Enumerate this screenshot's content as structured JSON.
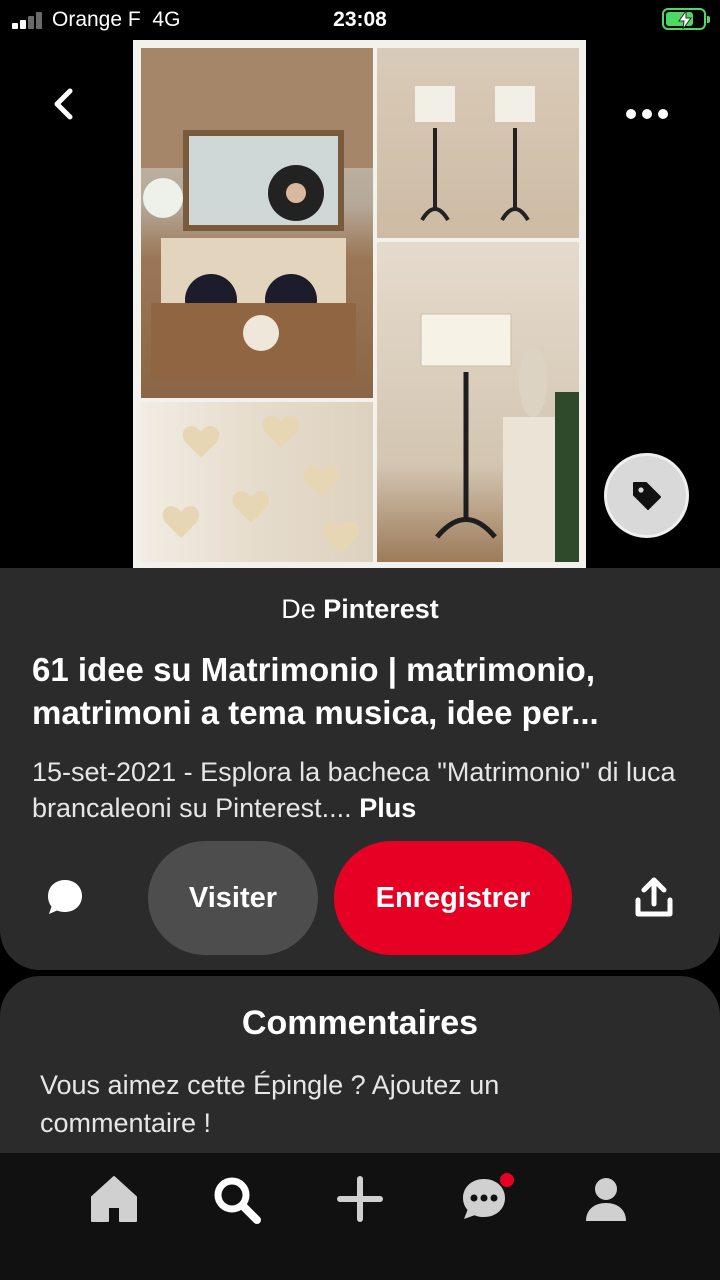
{
  "status_bar": {
    "carrier": "Orange F",
    "network": "4G",
    "time": "23:08",
    "battery_level": 0.75,
    "battery_charging": true,
    "signal_bars_active": 2,
    "signal_bars_total": 4
  },
  "header": {
    "back_icon": "chevron-left-icon",
    "more_icon": "more-horizontal-icon",
    "tag_icon": "tag-icon"
  },
  "pin": {
    "source_prefix": "De",
    "source_name": "Pinterest",
    "title": "61 idee su Matrimonio | matrimonio, matrimoni a tema musica, idee per...",
    "description": "15-set-2021 - Esplora la bacheca \"Matrimonio\" di luca brancaleoni su Pinterest.... ",
    "more_label": "Plus"
  },
  "actions": {
    "comment_icon": "comment-bubble-icon",
    "visit_label": "Visiter",
    "save_label": "Enregistrer",
    "share_icon": "share-icon"
  },
  "comments": {
    "title": "Commentaires",
    "prompt": "Vous aimez cette Épingle ? Ajoutez un commentaire !"
  },
  "bottom_nav": {
    "items": [
      {
        "icon": "home-icon"
      },
      {
        "icon": "search-icon",
        "active": true
      },
      {
        "icon": "plus-icon"
      },
      {
        "icon": "messages-icon",
        "has_notification": true
      },
      {
        "icon": "profile-icon"
      }
    ]
  },
  "colors": {
    "brand_red": "#e60023",
    "card_bg": "#2b2b2b",
    "visit_bg": "#4d4d4d",
    "battery_green": "#4cd964"
  }
}
